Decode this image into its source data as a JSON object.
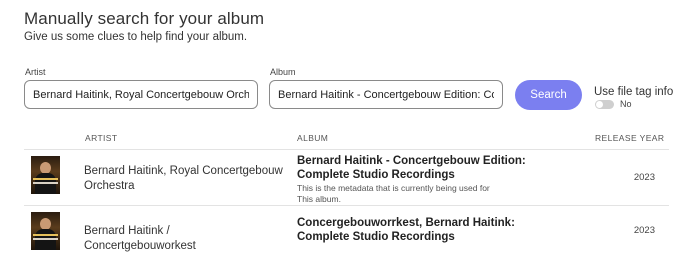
{
  "header": {
    "title": "Manually search for your album",
    "subtitle": "Give us some clues to help find your album."
  },
  "form": {
    "artist_label": "Artist",
    "artist_value": "Bernard Haitink, Royal Concertgebouw Orchestra",
    "album_label": "Album",
    "album_value": "Bernard Haitink - Concertgebouw Edition: Complete Studio Recordings",
    "search_label": "Search",
    "file_tag_label": "Use file tag info",
    "file_tag_state": "No"
  },
  "results": {
    "columns": {
      "artist": "ARTIST",
      "album": "ALBUM",
      "year": "RELEASE YEAR"
    },
    "rows": [
      {
        "artist": "Bernard Haitink, Royal Concertgebouw Orchestra",
        "album": "Bernard Haitink - Concertgebouw Edition: Complete Studio Recordings",
        "note": "This is the metadata that is currently being used for This album.",
        "year": "2023"
      },
      {
        "artist": "Bernard Haitink / Concertgebouworkest",
        "album": "Concergebouworrkest, Bernard Haitink: Complete Studio Recordings",
        "note": "",
        "year": "2023"
      }
    ]
  },
  "colors": {
    "accent": "#7b7ff0"
  }
}
